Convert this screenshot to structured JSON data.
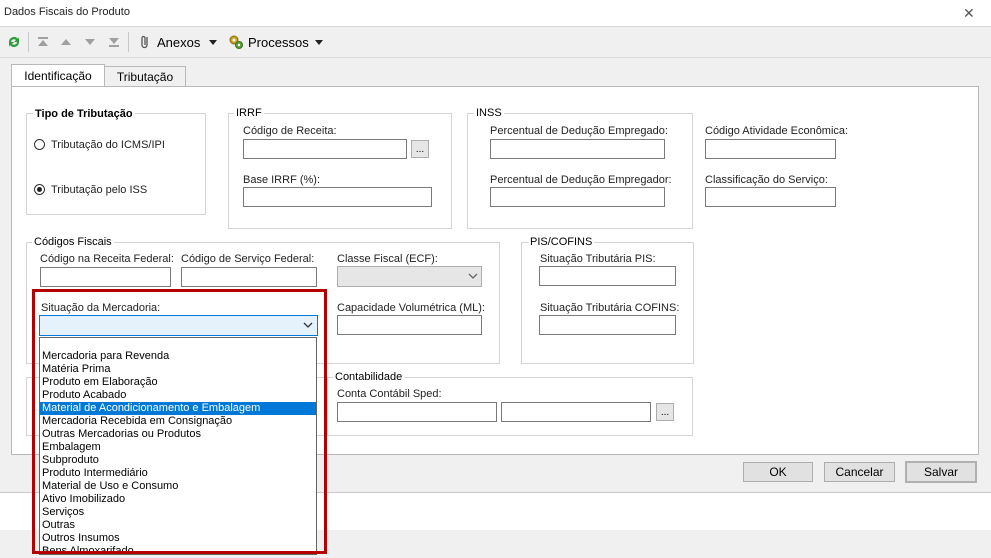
{
  "window": {
    "title": "Dados Fiscais do Produto",
    "close_glyph": "✕"
  },
  "toolbar": {
    "anexos": "Anexos",
    "processos": "Processos"
  },
  "tabs": [
    {
      "label": "Identificação"
    },
    {
      "label": "Tributação"
    }
  ],
  "tipo_tributacao": {
    "title": "Tipo de Tributação",
    "options": [
      {
        "label": "Tributação do ICMS/IPI",
        "checked": false
      },
      {
        "label": "Tributação pelo ISS",
        "checked": true
      }
    ]
  },
  "irrf": {
    "title": "IRRF",
    "codigo_receita": "Código de Receita:",
    "base": "Base IRRF (%):",
    "lookup": "..."
  },
  "inss": {
    "title": "INSS",
    "perc_empregado": "Percentual de Dedução Empregado:",
    "perc_empregador": "Percentual de Dedução Empregador:",
    "codigo_atividade": "Código Atividade Econômica:",
    "classificacao": "Classificação do Serviço:"
  },
  "codigos_fiscais": {
    "title": "Códigos Fiscais",
    "codigo_receita_federal": "Código na Receita Federal:",
    "codigo_servico_federal": "Código de Serviço Federal:",
    "classe_fiscal": "Classe Fiscal (ECF):",
    "situacao_mercadoria": "Situação da Mercadoria:",
    "capacidade": "Capacidade Volumétrica (ML):"
  },
  "pis_cofins": {
    "title": "PIS/COFINS",
    "pis": "Situação Tributária PIS:",
    "cofins": "Situação Tributária COFINS:"
  },
  "contabilidade": {
    "title": "Contabilidade",
    "conta": "Conta Contábil Sped:",
    "lookup": "..."
  },
  "dropdown": {
    "items": [
      "Mercadoria para Revenda",
      "Matéria Prima",
      "Produto em Elaboração",
      "Produto Acabado",
      "Material de Acondicionamento e Embalagem",
      "Mercadoria Recebida em Consignação",
      "Outras Mercadorias ou Produtos",
      "Embalagem",
      "Subproduto",
      "Produto Intermediário",
      "Material de Uso e Consumo",
      "Ativo Imobilizado",
      "Serviços",
      "Outras",
      "Outros Insumos",
      "Bens Almoxarifado"
    ],
    "selected_index": 4
  },
  "buttons": {
    "ok": "OK",
    "cancelar": "Cancelar",
    "salvar": "Salvar"
  },
  "colors": {
    "highlight_box": "#b40000",
    "selection": "#0078d7"
  }
}
